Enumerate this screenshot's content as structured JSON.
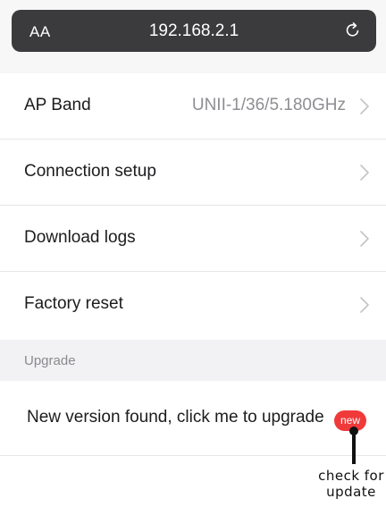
{
  "browser": {
    "text_size_label": "AA",
    "url": "192.168.2.1"
  },
  "settings": {
    "rows": [
      {
        "label": "AP Band",
        "value": "UNII-1/36/5.180GHz"
      },
      {
        "label": "Connection setup",
        "value": ""
      },
      {
        "label": "Download logs",
        "value": ""
      },
      {
        "label": "Factory reset",
        "value": ""
      }
    ]
  },
  "upgrade_section": {
    "header": "Upgrade",
    "message": "New version found, click me to upgrade",
    "badge": "new"
  },
  "annotation": {
    "text": "check for update"
  },
  "colors": {
    "url_bar": "#3b3b3d",
    "badge": "#f03a3a",
    "secondary_text": "#8e8e93"
  }
}
